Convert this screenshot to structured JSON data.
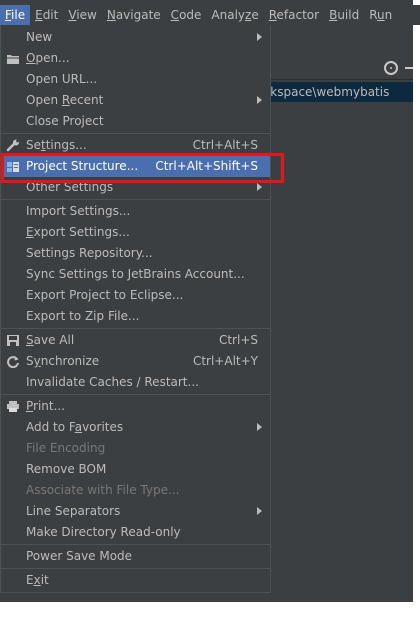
{
  "menubar": {
    "items": [
      {
        "pre": "",
        "mn": "F",
        "post": "ile"
      },
      {
        "pre": "",
        "mn": "E",
        "post": "dit"
      },
      {
        "pre": "",
        "mn": "V",
        "post": "iew"
      },
      {
        "pre": "",
        "mn": "N",
        "post": "avigate"
      },
      {
        "pre": "",
        "mn": "C",
        "post": "ode"
      },
      {
        "pre": "Analy",
        "mn": "z",
        "post": "e"
      },
      {
        "pre": "",
        "mn": "R",
        "post": "efactor"
      },
      {
        "pre": "",
        "mn": "B",
        "post": "uild"
      },
      {
        "pre": "R",
        "mn": "u",
        "post": "n"
      }
    ]
  },
  "editor": {
    "path": "orkspace\\webmybatis"
  },
  "file_menu": {
    "new": "New",
    "open": {
      "mn": "O",
      "post": "pen..."
    },
    "open_url": "Open URL...",
    "open_recent": {
      "pre": "Open ",
      "mn": "R",
      "post": "ecent"
    },
    "close_project": "Close Project",
    "settings": {
      "pre": "Se",
      "mn": "t",
      "post": "tings...",
      "shortcut": "Ctrl+Alt+S"
    },
    "project_structure": {
      "label": "Project Structure...",
      "shortcut": "Ctrl+Alt+Shift+S"
    },
    "other_settings": "Other Settings",
    "import_settings": "Import Settings...",
    "export_settings": {
      "mn": "E",
      "post": "xport Settings..."
    },
    "settings_repository": "Settings Repository...",
    "sync_settings": "Sync Settings to JetBrains Account...",
    "export_eclipse": "Export Project to Eclipse...",
    "export_zip": "Export to Zip File...",
    "save_all": {
      "mn": "S",
      "post": "ave All",
      "shortcut": "Ctrl+S"
    },
    "synchronize": {
      "pre": "S",
      "mn": "y",
      "post": "nchronize",
      "shortcut": "Ctrl+Alt+Y"
    },
    "invalidate": "Invalidate Caches / Restart...",
    "print": {
      "mn": "P",
      "post": "rint..."
    },
    "add_favorites": {
      "pre": "Add to F",
      "mn": "a",
      "post": "vorites"
    },
    "file_encoding": "File Encoding",
    "remove_bom": "Remove BOM",
    "associate": "Associate with File Type...",
    "line_separators": "Line Separators",
    "make_readonly": "Make Directory Read-only",
    "power_save": "Power Save Mode",
    "exit": {
      "pre": "E",
      "mn": "x",
      "post": "it"
    }
  },
  "colors": {
    "menu_bg": "#3c3f41",
    "selection": "#4b6eaf",
    "highlight_box": "#e8141b",
    "disabled_text": "#777777"
  }
}
